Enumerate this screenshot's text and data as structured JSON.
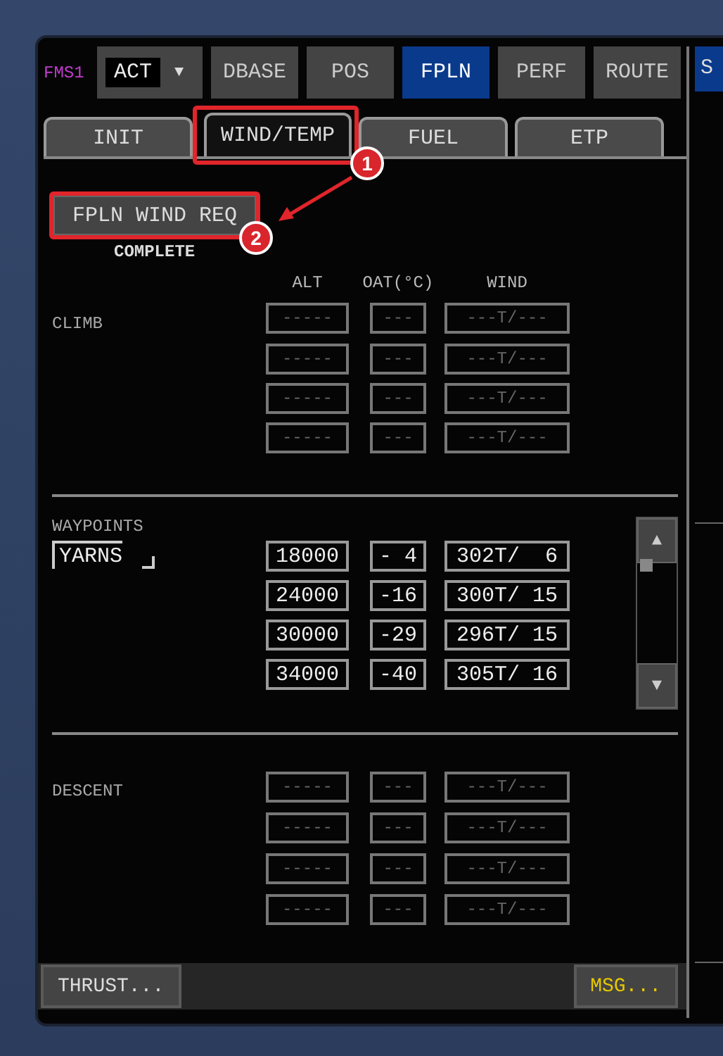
{
  "top_bar": {
    "unit": "FMS1",
    "mode": {
      "value": "ACT",
      "caret": "▼"
    },
    "tabs": [
      {
        "label": "DBASE",
        "selected": false
      },
      {
        "label": "POS",
        "selected": false
      },
      {
        "label": "FPLN",
        "selected": true
      },
      {
        "label": "PERF",
        "selected": false
      },
      {
        "label": "ROUTE",
        "selected": false
      }
    ],
    "side_tab": {
      "label": "S",
      "selected": true
    }
  },
  "sub_tabs": [
    {
      "label": "INIT",
      "selected": false,
      "highlighted": false
    },
    {
      "label": "WIND/TEMP",
      "selected": true,
      "highlighted": true
    },
    {
      "label": "FUEL",
      "selected": false,
      "highlighted": false
    },
    {
      "label": "ETP",
      "selected": false,
      "highlighted": false
    }
  ],
  "request": {
    "button": "FPLN WIND REQ",
    "highlighted": true,
    "status": "COMPLETE"
  },
  "columns": [
    "ALT",
    "OAT(°C)",
    "WIND"
  ],
  "sections": [
    {
      "kind": "climb",
      "label": "CLIMB",
      "rows": [
        {
          "alt": "-----",
          "oat": "---",
          "wind": "---T/---",
          "empty": true
        },
        {
          "alt": "-----",
          "oat": "---",
          "wind": "---T/---",
          "empty": true
        },
        {
          "alt": "-----",
          "oat": "---",
          "wind": "---T/---",
          "empty": true
        },
        {
          "alt": "-----",
          "oat": "---",
          "wind": "---T/---",
          "empty": true
        }
      ]
    },
    {
      "kind": "waypoints",
      "label": "WAYPOINTS",
      "waypoint": "YARNS",
      "scroll": {
        "up": "▲",
        "down": "▼"
      },
      "rows": [
        {
          "alt": "18000",
          "oat": "- 4",
          "wind": "302T/  6",
          "empty": false
        },
        {
          "alt": "24000",
          "oat": "-16",
          "wind": "300T/ 15",
          "empty": false
        },
        {
          "alt": "30000",
          "oat": "-29",
          "wind": "296T/ 15",
          "empty": false
        },
        {
          "alt": "34000",
          "oat": "-40",
          "wind": "305T/ 16",
          "empty": false
        }
      ]
    },
    {
      "kind": "descent",
      "label": "DESCENT",
      "rows": [
        {
          "alt": "-----",
          "oat": "---",
          "wind": "---T/---",
          "empty": true
        },
        {
          "alt": "-----",
          "oat": "---",
          "wind": "---T/---",
          "empty": true
        },
        {
          "alt": "-----",
          "oat": "---",
          "wind": "---T/---",
          "empty": true
        },
        {
          "alt": "-----",
          "oat": "---",
          "wind": "---T/---",
          "empty": true
        }
      ]
    }
  ],
  "bottom_bar": {
    "left": "THRUST...",
    "right": "MSG..."
  },
  "annotations": [
    {
      "label": "1"
    },
    {
      "label": "2"
    }
  ]
}
